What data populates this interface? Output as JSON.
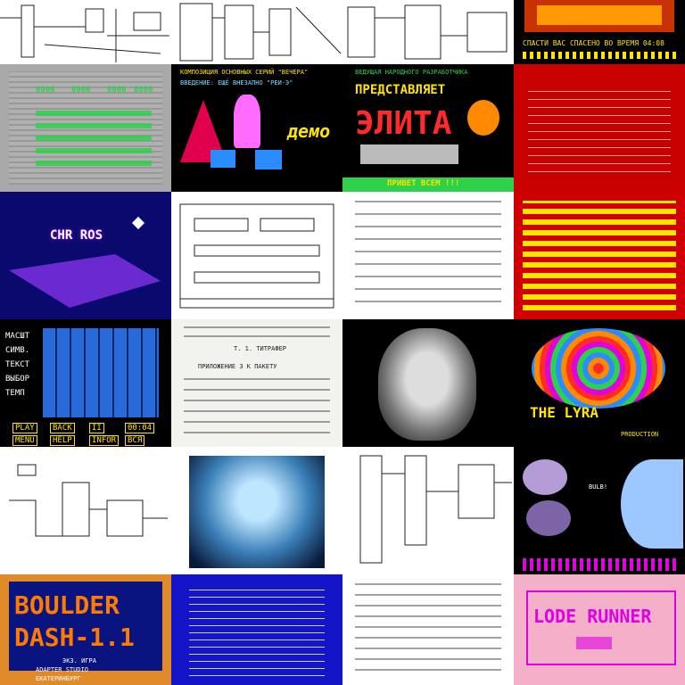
{
  "grid": {
    "tiles": [
      {
        "id": "t00",
        "label": ""
      },
      {
        "id": "t01",
        "label": ""
      },
      {
        "id": "t02",
        "label": ""
      },
      {
        "id": "t03",
        "caption": "СПАСТИ ВАС СПАСЕНО ВО ВРЕМЯ 04:08"
      },
      {
        "id": "t10",
        "labels": [
          "0000",
          "0000",
          "0000",
          "0000"
        ]
      },
      {
        "id": "t11",
        "heading": "КОМПОЗИЦИЯ ОСНОВНЫХ СЕРИЙ \"ВЕЧЕРА\"",
        "subheading": "ВВЕДЕНИЕ: ЕЩЁ ВНЕЗАПНО \"РЕИ-Э\"",
        "demo": "демо"
      },
      {
        "id": "t12",
        "top": "ВЕДУЩАЯ НАРОДНОГО РАЗРАБОТЧИКА",
        "present": "ПРЕДСТАВЛЯЕТ",
        "title": "ЭЛИТА",
        "bottom": "ПРИВЕТ ВСЕМ !!!"
      },
      {
        "id": "t13"
      },
      {
        "id": "t20",
        "title": "CHR ROS"
      },
      {
        "id": "t21"
      },
      {
        "id": "t22"
      },
      {
        "id": "t23"
      },
      {
        "id": "t30",
        "labels": [
          "МАСШТ",
          "СИМВ.",
          "ТЕКСТ",
          "ВЫБОР",
          "ТЕМП"
        ],
        "buttons": [
          "PLAY",
          "BACK",
          "II",
          "00:04",
          "MENU",
          "HELP",
          "INFOR",
          "ВСЯ"
        ]
      },
      {
        "id": "t31",
        "text": [
          "ПРИЛОЖЕНИЕ 3 К ПАКЕТУ",
          "Т. 1. ТИТРАФЕР"
        ]
      },
      {
        "id": "t32"
      },
      {
        "id": "t33",
        "title": "THE LYRA",
        "sub": "PRODUCTION"
      },
      {
        "id": "t40"
      },
      {
        "id": "t41"
      },
      {
        "id": "t42"
      },
      {
        "id": "t43",
        "text": "BULB!"
      },
      {
        "id": "t50",
        "title1": "BOULDER",
        "title2": "DASH-1.1",
        "lines": [
          "ЭКЗ. ИГРА",
          "ADAPTER STUDIO",
          "ЕКАТЕРИНБУРГ"
        ]
      },
      {
        "id": "t51"
      },
      {
        "id": "t52"
      },
      {
        "id": "t53",
        "title": "LODE RUNNER"
      }
    ]
  }
}
